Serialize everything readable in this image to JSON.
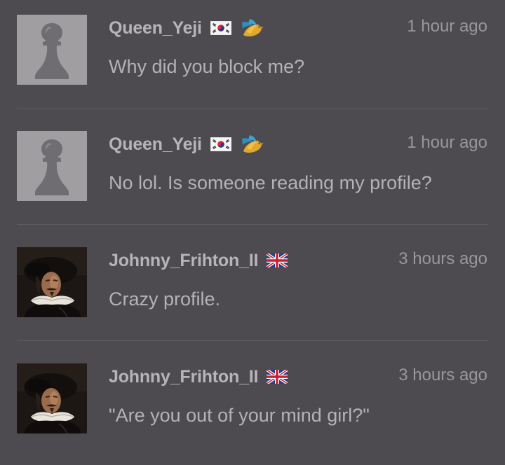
{
  "messages": [
    {
      "username": "Queen_Yeji",
      "avatar": "pawn-icon",
      "flag": "south-korea-flag-icon",
      "flair": "bird-icon",
      "time": "1 hour ago",
      "text": "Why did you block me?"
    },
    {
      "username": "Queen_Yeji",
      "avatar": "pawn-icon",
      "flag": "south-korea-flag-icon",
      "flair": "bird-icon",
      "time": "1 hour ago",
      "text": "No lol. Is someone reading my profile?"
    },
    {
      "username": "Johnny_Frihton_II",
      "avatar": "portrait-avatar",
      "flag": "united-kingdom-flag-icon",
      "time": "3 hours ago",
      "text": "Crazy profile."
    },
    {
      "username": "Johnny_Frihton_II",
      "avatar": "portrait-avatar",
      "flag": "united-kingdom-flag-icon",
      "time": "3 hours ago",
      "text": "\"Are you out of your mind girl?\""
    }
  ],
  "colors": {
    "background": "#4d4b4f",
    "username": "#b7b4b8",
    "text": "#b5b2b6",
    "time": "#9a979b",
    "divider": "#5e5c60"
  }
}
